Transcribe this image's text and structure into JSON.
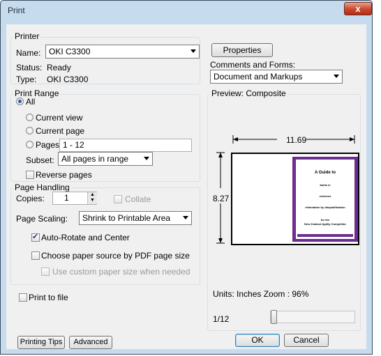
{
  "window": {
    "title": "Print",
    "close_glyph": "x"
  },
  "printer": {
    "group_label": "Printer",
    "name_label": "Name:",
    "name_value": "OKI C3300",
    "status_label": "Status:",
    "status_value": "Ready",
    "type_label": "Type:",
    "type_value": "OKI C3300",
    "properties_label": "Properties",
    "comments_label": "Comments and Forms:",
    "comments_value": "Document and Markups"
  },
  "print_range": {
    "group_label": "Print Range",
    "options": [
      {
        "label": "All",
        "selected": true
      },
      {
        "label": "Current view",
        "selected": false
      },
      {
        "label": "Current page",
        "selected": false
      },
      {
        "label": "Pages",
        "selected": false
      }
    ],
    "pages_value": "1 - 12",
    "subset_label": "Subset:",
    "subset_value": "All pages in range",
    "reverse_label": "Reverse pages",
    "reverse_checked": false
  },
  "page_handling": {
    "group_label": "Page Handling",
    "copies_label": "Copies:",
    "copies_value": "1",
    "collate_label": "Collate",
    "collate_checked": false,
    "scaling_label": "Page Scaling:",
    "scaling_value": "Shrink to Printable Area",
    "auto_rotate_label": "Auto-Rotate and Center",
    "auto_rotate_checked": true,
    "paper_source_label": "Choose paper source by PDF page size",
    "paper_source_checked": false,
    "custom_paper_label": "Use custom paper size when needed",
    "custom_paper_checked": false
  },
  "print_to_file": {
    "label": "Print to file",
    "checked": false
  },
  "preview": {
    "group_label": "Preview: Composite",
    "width_value": "11.69",
    "height_value": "8.27",
    "doc_lines": [
      "A Guide to",
      "faults in",
      "retrieves",
      "elimination by disqualification",
      "for the",
      "New Zealand Agility Competitor"
    ],
    "units_zoom": "Units: Inches Zoom :  96%",
    "page_indicator": "1/12",
    "accent_color": "#6b2d8f"
  },
  "footer": {
    "printing_tips_label": "Printing Tips",
    "advanced_label": "Advanced",
    "ok_label": "OK",
    "cancel_label": "Cancel"
  }
}
